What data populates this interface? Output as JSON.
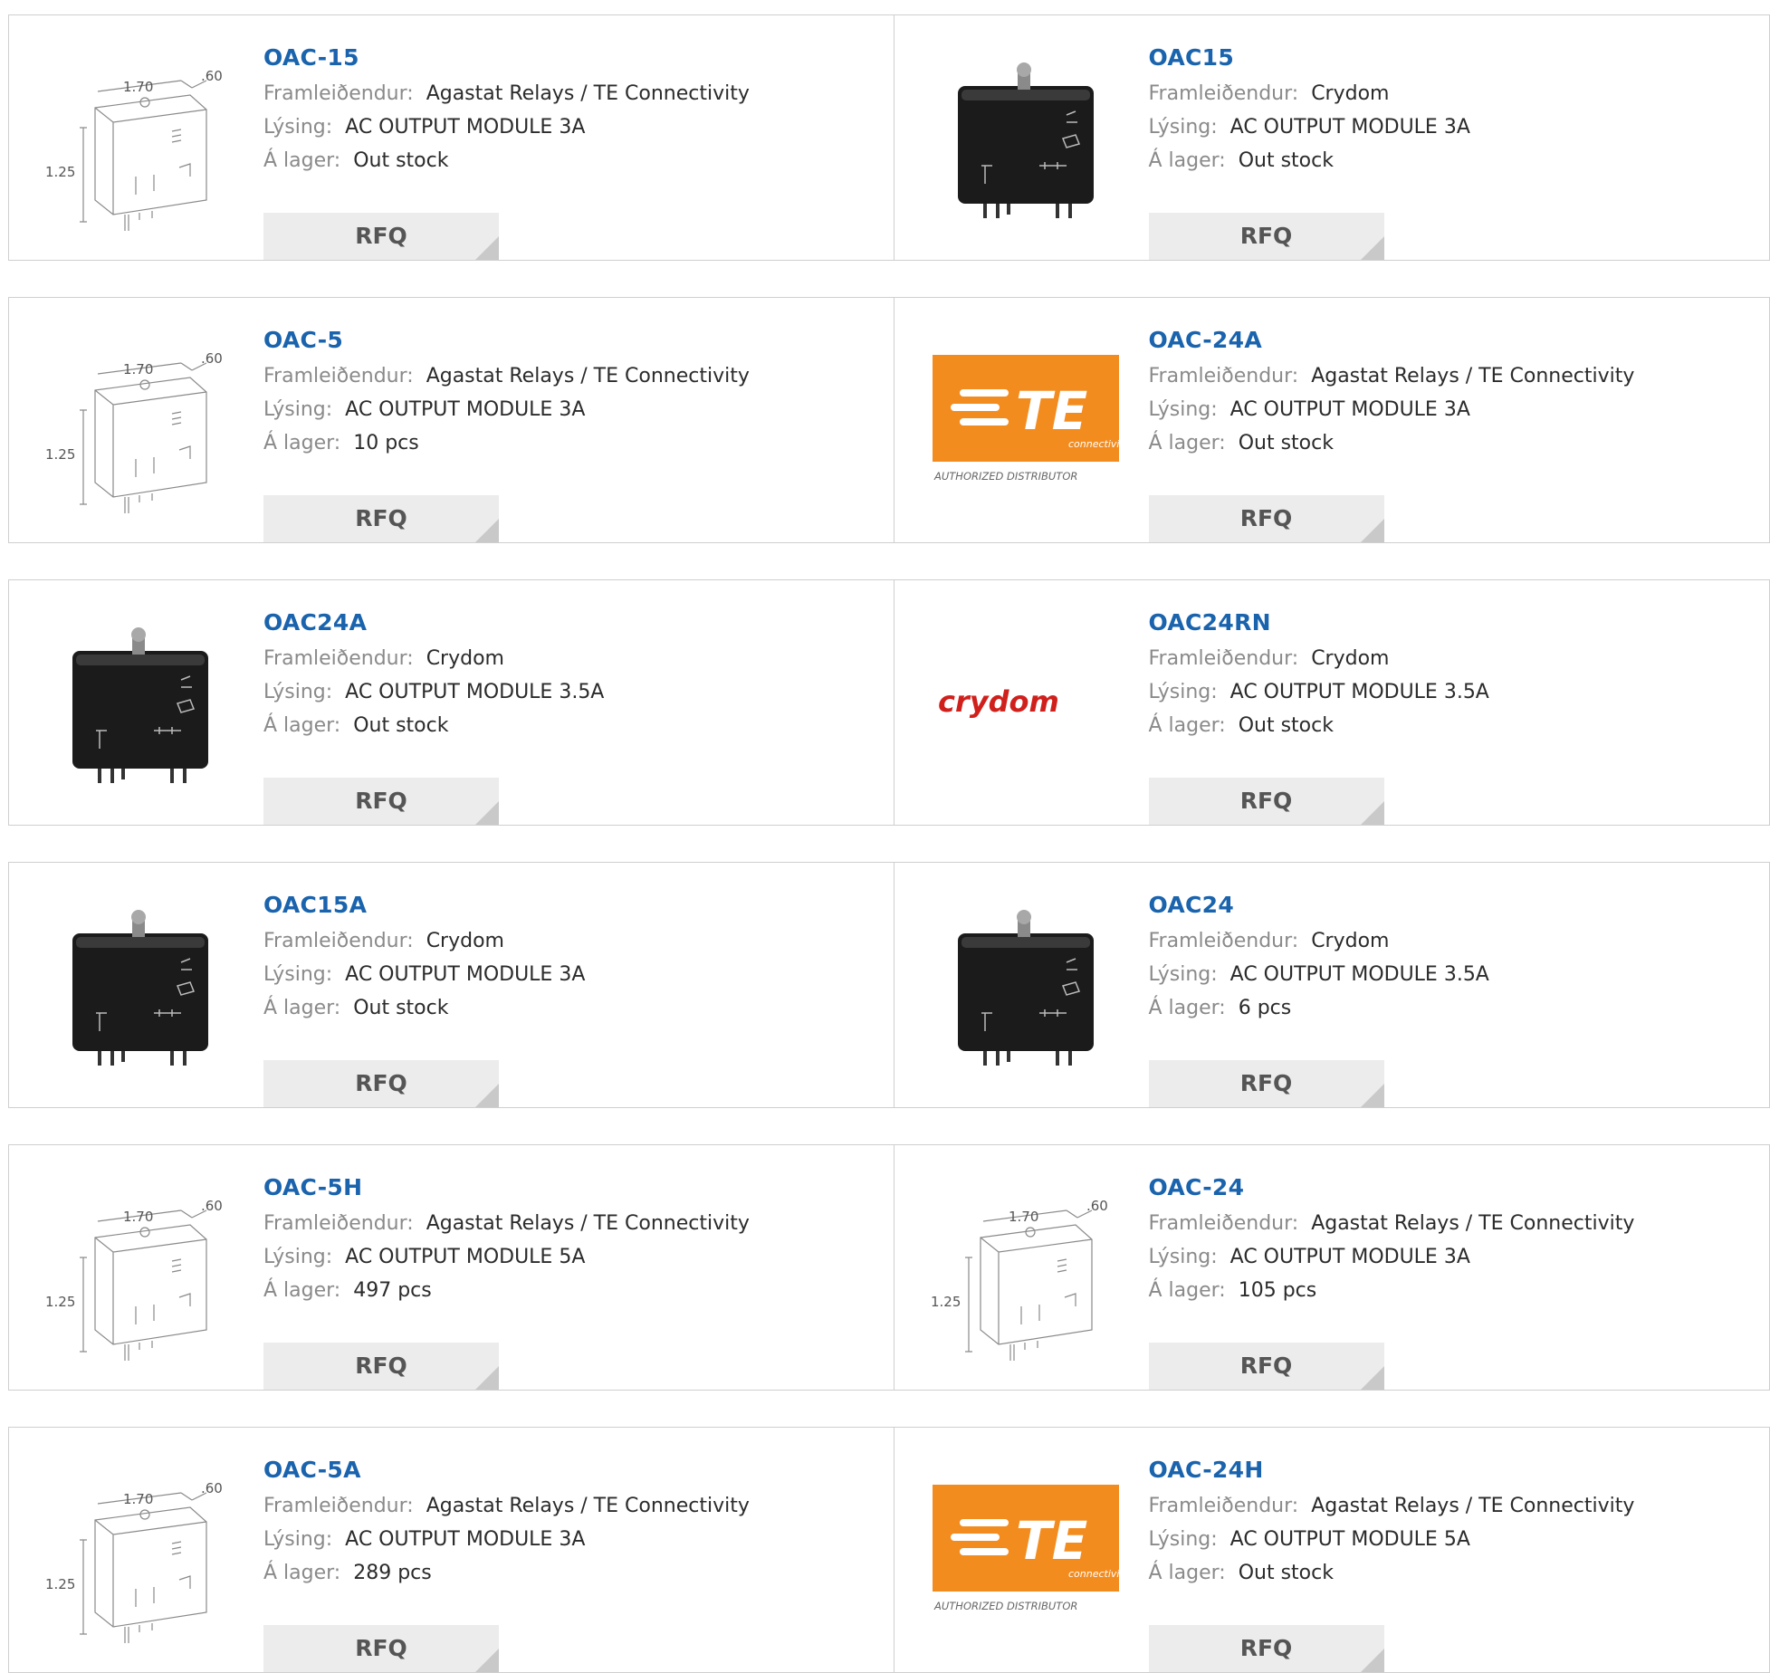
{
  "labels": {
    "manufacturer": "Framleiðendur:",
    "description": "Lýsing:",
    "stock": "Á lager:",
    "rfq": "RFQ"
  },
  "colors": {
    "part_link": "#1a63ad",
    "label": "#8a8a8a",
    "value": "#2b2b2b",
    "rfq_bg": "#ececec",
    "te_orange": "#f38c1f",
    "crydom_red": "#d0201c"
  },
  "dimension_drawing_labels": {
    "length": "1.70",
    "depth": ".60",
    "height": "1.25"
  },
  "te_logo": {
    "brand": "TE",
    "sub": "connectivity",
    "badge": "AUTHORIZED DISTRIBUTOR"
  },
  "crydom_logo": {
    "brand": "crydom"
  },
  "products": [
    {
      "part": "OAC-15",
      "manufacturer": "Agastat Relays / TE Connectivity",
      "description": "AC OUTPUT MODULE 3A",
      "stock": "Out stock",
      "image": "dimension-drawing"
    },
    {
      "part": "OAC15",
      "manufacturer": "Crydom",
      "description": "AC OUTPUT MODULE 3A",
      "stock": "Out stock",
      "image": "crydom-module-photo"
    },
    {
      "part": "OAC-5",
      "manufacturer": "Agastat Relays / TE Connectivity",
      "description": "AC OUTPUT MODULE 3A",
      "stock": "10 pcs",
      "image": "dimension-drawing"
    },
    {
      "part": "OAC-24A",
      "manufacturer": "Agastat Relays / TE Connectivity",
      "description": "AC OUTPUT MODULE 3A",
      "stock": "Out stock",
      "image": "te-logo"
    },
    {
      "part": "OAC24A",
      "manufacturer": "Crydom",
      "description": "AC OUTPUT MODULE 3.5A",
      "stock": "Out stock",
      "image": "crydom-module-photo"
    },
    {
      "part": "OAC24RN",
      "manufacturer": "Crydom",
      "description": "AC OUTPUT MODULE 3.5A",
      "stock": "Out stock",
      "image": "crydom-logo"
    },
    {
      "part": "OAC15A",
      "manufacturer": "Crydom",
      "description": "AC OUTPUT MODULE 3A",
      "stock": "Out stock",
      "image": "crydom-module-photo"
    },
    {
      "part": "OAC24",
      "manufacturer": "Crydom",
      "description": "AC OUTPUT MODULE 3.5A",
      "stock": "6 pcs",
      "image": "crydom-module-photo"
    },
    {
      "part": "OAC-5H",
      "manufacturer": "Agastat Relays / TE Connectivity",
      "description": "AC OUTPUT MODULE 5A",
      "stock": "497 pcs",
      "image": "dimension-drawing"
    },
    {
      "part": "OAC-24",
      "manufacturer": "Agastat Relays / TE Connectivity",
      "description": "AC OUTPUT MODULE 3A",
      "stock": "105 pcs",
      "image": "dimension-drawing"
    },
    {
      "part": "OAC-5A",
      "manufacturer": "Agastat Relays / TE Connectivity",
      "description": "AC OUTPUT MODULE 3A",
      "stock": "289 pcs",
      "image": "dimension-drawing"
    },
    {
      "part": "OAC-24H",
      "manufacturer": "Agastat Relays / TE Connectivity",
      "description": "AC OUTPUT MODULE 5A",
      "stock": "Out stock",
      "image": "te-logo"
    }
  ]
}
